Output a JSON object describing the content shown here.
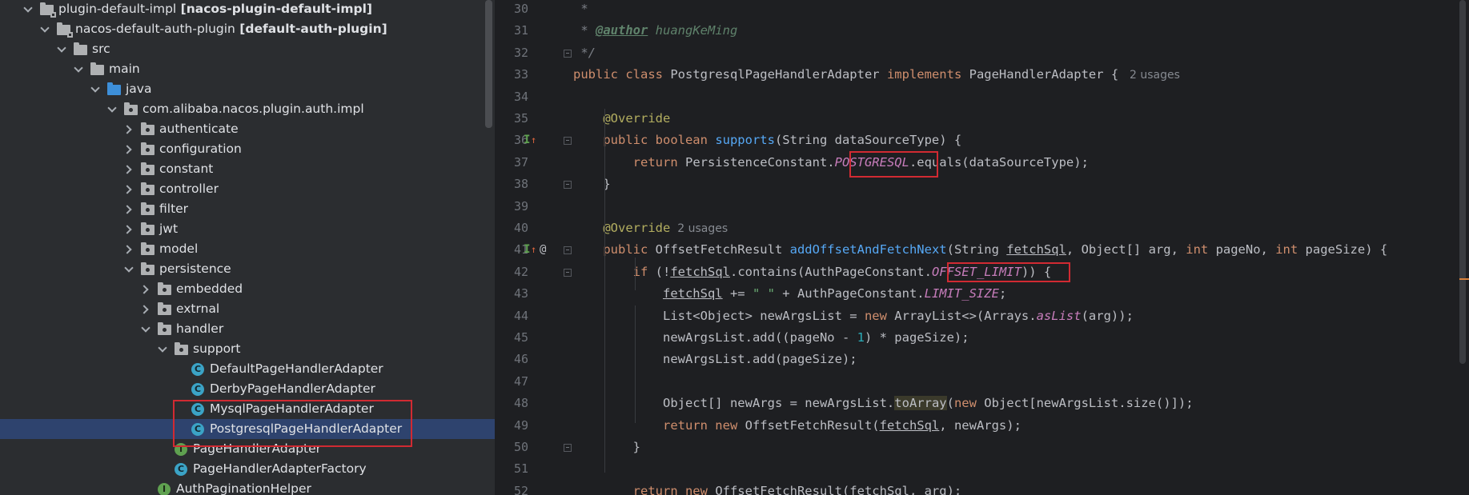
{
  "tree": {
    "items": [
      {
        "label": "plugin-default-impl",
        "bold": "[nacos-plugin-default-impl]",
        "icon": "module-folder-icon",
        "chev": "down"
      },
      {
        "label": "nacos-default-auth-plugin",
        "bold": "[default-auth-plugin]",
        "icon": "module-folder-icon",
        "chev": "down"
      },
      {
        "label": "src",
        "bold": "",
        "icon": "folder-icon",
        "chev": "down"
      },
      {
        "label": "main",
        "bold": "",
        "icon": "folder-icon",
        "chev": "down"
      },
      {
        "label": "java",
        "bold": "",
        "icon": "source-folder-icon",
        "chev": "down"
      },
      {
        "label": "com.alibaba.nacos.plugin.auth.impl",
        "bold": "",
        "icon": "package-icon",
        "chev": "down"
      },
      {
        "label": "authenticate",
        "bold": "",
        "icon": "package-icon",
        "chev": "right"
      },
      {
        "label": "configuration",
        "bold": "",
        "icon": "package-icon",
        "chev": "right"
      },
      {
        "label": "constant",
        "bold": "",
        "icon": "package-icon",
        "chev": "right"
      },
      {
        "label": "controller",
        "bold": "",
        "icon": "package-icon",
        "chev": "right"
      },
      {
        "label": "filter",
        "bold": "",
        "icon": "package-icon",
        "chev": "right"
      },
      {
        "label": "jwt",
        "bold": "",
        "icon": "package-icon",
        "chev": "right"
      },
      {
        "label": "model",
        "bold": "",
        "icon": "package-icon",
        "chev": "right"
      },
      {
        "label": "persistence",
        "bold": "",
        "icon": "package-icon",
        "chev": "down"
      },
      {
        "label": "embedded",
        "bold": "",
        "icon": "package-icon",
        "chev": "right"
      },
      {
        "label": "extrnal",
        "bold": "",
        "icon": "package-icon",
        "chev": "right"
      },
      {
        "label": "handler",
        "bold": "",
        "icon": "package-icon",
        "chev": "down"
      },
      {
        "label": "support",
        "bold": "",
        "icon": "package-icon",
        "chev": "down"
      },
      {
        "label": "DefaultPageHandlerAdapter",
        "bold": "",
        "icon": "class-icon",
        "chev": ""
      },
      {
        "label": "DerbyPageHandlerAdapter",
        "bold": "",
        "icon": "class-icon",
        "chev": ""
      },
      {
        "label": "MysqlPageHandlerAdapter",
        "bold": "",
        "icon": "class-icon",
        "chev": ""
      },
      {
        "label": "PostgresqlPageHandlerAdapter",
        "bold": "",
        "icon": "class-icon",
        "chev": "",
        "selected": true
      },
      {
        "label": "PageHandlerAdapter",
        "bold": "",
        "icon": "interface-icon",
        "chev": ""
      },
      {
        "label": "PageHandlerAdapterFactory",
        "bold": "",
        "icon": "class-icon",
        "chev": ""
      },
      {
        "label": "AuthPaginationHelper",
        "bold": "",
        "icon": "interface-icon",
        "chev": ""
      }
    ],
    "class_glyph": "C",
    "interface_glyph": "I"
  },
  "editor": {
    "lines": [
      {
        "n": "30",
        "tokens": [
          [
            "cm",
            " *"
          ]
        ]
      },
      {
        "n": "31",
        "tokens": [
          [
            "cm",
            " * "
          ],
          [
            "cmtag",
            "@author"
          ],
          [
            "cmtxt",
            " huangKeMing"
          ]
        ]
      },
      {
        "n": "32",
        "tokens": [
          [
            "cm",
            " */"
          ]
        ]
      },
      {
        "n": "33",
        "tokens": [
          [
            "kw",
            "public class "
          ],
          [
            "",
            "PostgresqlPageHandlerAdapter "
          ],
          [
            "kw",
            "implements "
          ],
          [
            "",
            "PageHandlerAdapter { "
          ],
          [
            "hint",
            " 2 usages"
          ]
        ]
      },
      {
        "n": "34",
        "tokens": []
      },
      {
        "n": "35",
        "tokens": [
          [
            "",
            "    "
          ],
          [
            "an",
            "@Override"
          ]
        ]
      },
      {
        "n": "36",
        "tokens": [
          [
            "",
            "    "
          ],
          [
            "kw",
            "public boolean "
          ],
          [
            "fn",
            "supports"
          ],
          [
            "",
            "(String dataSourceType) {"
          ]
        ]
      },
      {
        "n": "37",
        "tokens": [
          [
            "",
            "        "
          ],
          [
            "kw",
            "return "
          ],
          [
            "",
            "PersistenceConstant."
          ],
          [
            "cst",
            "POSTGRESQL"
          ],
          [
            "",
            ".equals(dataSourceType);"
          ]
        ]
      },
      {
        "n": "38",
        "tokens": [
          [
            "",
            "    }"
          ]
        ]
      },
      {
        "n": "39",
        "tokens": []
      },
      {
        "n": "40",
        "tokens": [
          [
            "",
            "    "
          ],
          [
            "an",
            "@Override"
          ],
          [
            "hint",
            "  2 usages"
          ]
        ]
      },
      {
        "n": "41",
        "tokens": [
          [
            "",
            "    "
          ],
          [
            "kw",
            "public "
          ],
          [
            "",
            "OffsetFetchResult "
          ],
          [
            "fn",
            "addOffsetAndFetchNext"
          ],
          [
            "",
            "(String "
          ],
          [
            "ul",
            "fetchSql"
          ],
          [
            "",
            ", Object[] arg, "
          ],
          [
            "kw",
            "int "
          ],
          [
            "",
            "pageNo, "
          ],
          [
            "kw",
            "int "
          ],
          [
            "",
            "pageSize) {"
          ]
        ]
      },
      {
        "n": "42",
        "tokens": [
          [
            "",
            "        "
          ],
          [
            "kw",
            "if "
          ],
          [
            "",
            "(!"
          ],
          [
            "ul",
            "fetchSql"
          ],
          [
            "",
            ".contains(AuthPageConstant."
          ],
          [
            "cst",
            "OFFSET_LIMIT"
          ],
          [
            "",
            ")) {"
          ]
        ]
      },
      {
        "n": "43",
        "tokens": [
          [
            "",
            "            "
          ],
          [
            "ul",
            "fetchSql"
          ],
          [
            "",
            " += "
          ],
          [
            "str",
            "\" \""
          ],
          [
            "",
            " + AuthPageConstant."
          ],
          [
            "cst",
            "LIMIT_SIZE"
          ],
          [
            "",
            ";"
          ]
        ]
      },
      {
        "n": "44",
        "tokens": [
          [
            "",
            "            List<Object> newArgsList = "
          ],
          [
            "kw",
            "new "
          ],
          [
            "",
            "ArrayList<>(Arrays."
          ],
          [
            "cst",
            "asList"
          ],
          [
            "",
            "(arg));"
          ]
        ]
      },
      {
        "n": "45",
        "tokens": [
          [
            "",
            "            newArgsList.add((pageNo - "
          ],
          [
            "num",
            "1"
          ],
          [
            "",
            ") * pageSize);"
          ]
        ]
      },
      {
        "n": "46",
        "tokens": [
          [
            "",
            "            newArgsList.add(pageSize);"
          ]
        ]
      },
      {
        "n": "47",
        "tokens": []
      },
      {
        "n": "48",
        "tokens": [
          [
            "",
            "            Object[] newArgs = newArgsList."
          ],
          [
            "hl",
            "toArray"
          ],
          [
            "",
            "("
          ],
          [
            "kw",
            "new "
          ],
          [
            "",
            "Object[newArgsList.size()]);"
          ]
        ]
      },
      {
        "n": "49",
        "tokens": [
          [
            "",
            "            "
          ],
          [
            "kw",
            "return new "
          ],
          [
            "",
            "OffsetFetchResult("
          ],
          [
            "ul",
            "fetchSql"
          ],
          [
            "",
            ", newArgs);"
          ]
        ]
      },
      {
        "n": "50",
        "tokens": [
          [
            "",
            "        }"
          ]
        ]
      },
      {
        "n": "51",
        "tokens": []
      },
      {
        "n": "52",
        "tokens": [
          [
            "",
            "        "
          ],
          [
            "kw",
            "return new "
          ],
          [
            "",
            "OffsetFetchResult(fetchSql, arg);"
          ]
        ]
      }
    ],
    "gutter": {
      "implements_glyph": "I",
      "override_arrow": "↑",
      "at_glyph": "@"
    }
  }
}
